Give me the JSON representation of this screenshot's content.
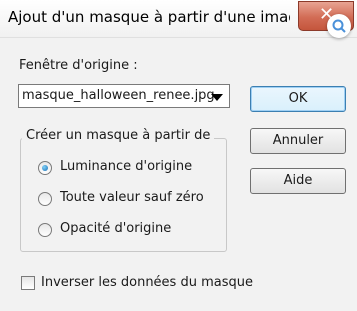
{
  "window": {
    "title": "Ajout d'un masque à partir d'une image",
    "close_label": "✕",
    "close_icon": "close-icon",
    "lens_icon": "magnifier-icon"
  },
  "source": {
    "label": "Fenêtre d'origine :",
    "selected": "masque_halloween_renee.jpg"
  },
  "buttons": {
    "ok": "OK",
    "cancel": "Annuler",
    "help": "Aide"
  },
  "group": {
    "title": "Créer un masque à partir de",
    "options": [
      {
        "label": "Luminance d'origine",
        "checked": true
      },
      {
        "label": "Toute valeur sauf zéro",
        "checked": false
      },
      {
        "label": "Opacité d'origine",
        "checked": false
      }
    ]
  },
  "invert": {
    "label": "Inverser les données du masque",
    "checked": false
  },
  "colors": {
    "accent": "#1a6fb5",
    "close": "#c4553c"
  }
}
